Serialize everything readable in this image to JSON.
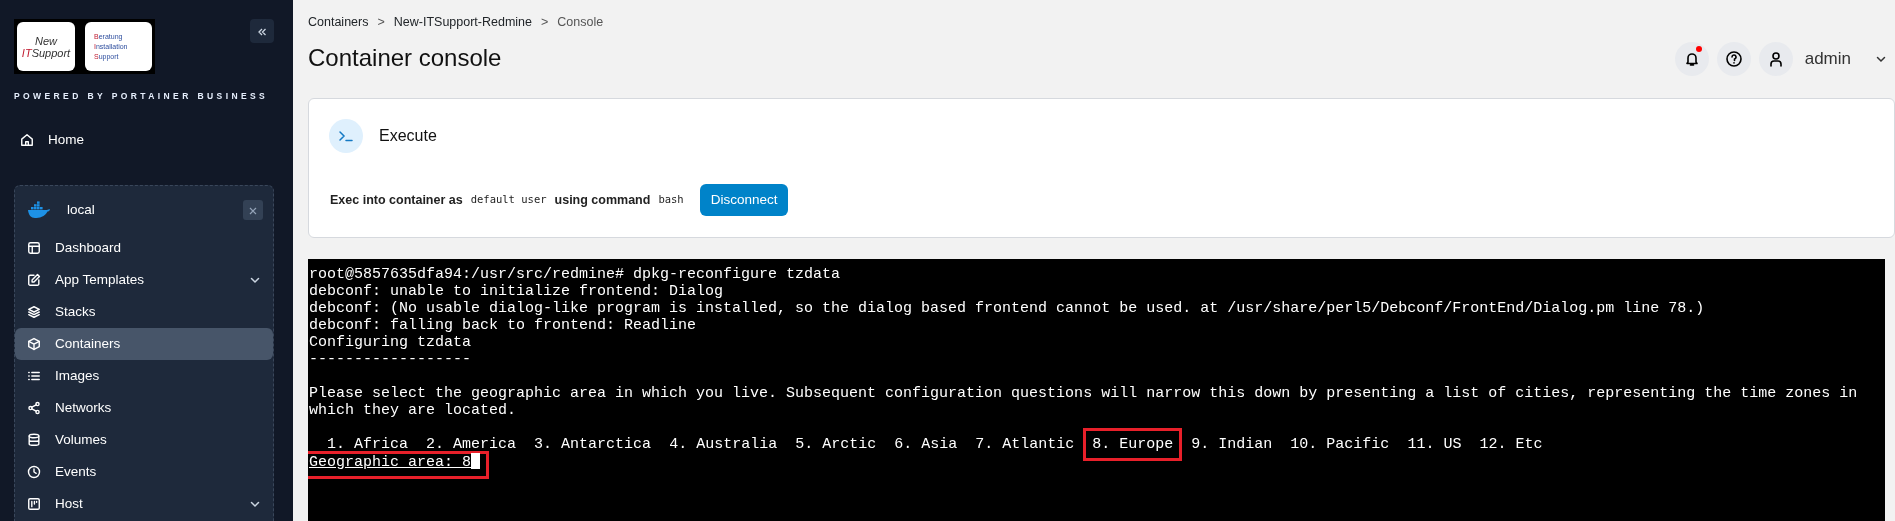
{
  "sidebar": {
    "logo": {
      "left": [
        {
          "text": "New"
        },
        {
          "accent": "IT",
          "text": "Support"
        }
      ],
      "right": [
        {
          "accent": "B",
          "text": "eratung"
        },
        {
          "accent": "I",
          "text": "nstallation"
        },
        {
          "accent": "S",
          "text": "upport"
        }
      ]
    },
    "powered_by": "POWERED BY PORTAINER BUSINESS",
    "home": {
      "label": "Home"
    },
    "environment": {
      "name": "local",
      "items": [
        {
          "label": "Dashboard",
          "expandable": false,
          "selected": false
        },
        {
          "label": "App Templates",
          "expandable": true,
          "selected": false
        },
        {
          "label": "Stacks",
          "expandable": false,
          "selected": false
        },
        {
          "label": "Containers",
          "expandable": false,
          "selected": true
        },
        {
          "label": "Images",
          "expandable": false,
          "selected": false
        },
        {
          "label": "Networks",
          "expandable": false,
          "selected": false
        },
        {
          "label": "Volumes",
          "expandable": false,
          "selected": false
        },
        {
          "label": "Events",
          "expandable": false,
          "selected": false
        },
        {
          "label": "Host",
          "expandable": true,
          "selected": false
        }
      ]
    }
  },
  "breadcrumb": [
    {
      "kind": "link",
      "text": "Containers"
    },
    {
      "kind": "separator",
      "text": ">"
    },
    {
      "kind": "link",
      "text": "New-ITSupport-Redmine"
    },
    {
      "kind": "separator",
      "text": ">"
    },
    {
      "kind": "current",
      "text": "Console"
    }
  ],
  "page_title": "Container console",
  "header": {
    "notification_dot": true,
    "user": "admin"
  },
  "execute_card": {
    "title": "Execute",
    "parts": [
      {
        "kind": "text",
        "text": "Exec into container as"
      },
      {
        "kind": "code",
        "text": "default user"
      },
      {
        "kind": "text",
        "text": "using command"
      },
      {
        "kind": "code",
        "text": "bash"
      }
    ],
    "button": "Disconnect"
  },
  "terminal": {
    "lines": [
      {
        "kind": "text",
        "text": "root@5857635dfa94:/usr/src/redmine# dpkg-reconfigure tzdata"
      },
      {
        "kind": "text",
        "text": "debconf: unable to initialize frontend: Dialog"
      },
      {
        "kind": "text",
        "text": "debconf: (No usable dialog-like program is installed, so the dialog based frontend cannot be used. at /usr/share/perl5/Debconf/FrontEnd/Dialog.pm line 78.)"
      },
      {
        "kind": "text",
        "text": "debconf: falling back to frontend: Readline"
      },
      {
        "kind": "text",
        "text": "Configuring tzdata"
      },
      {
        "kind": "text",
        "text": "------------------"
      },
      {
        "kind": "blank"
      },
      {
        "kind": "text",
        "text": "Please select the geographic area in which you live. Subsequent configuration questions will narrow this down by presenting a list of cities, representing the time zones in"
      },
      {
        "kind": "text",
        "text": "which they are located."
      },
      {
        "kind": "blank"
      },
      {
        "kind": "options",
        "options": [
          {
            "text": "1. Africa",
            "highlighted": false
          },
          {
            "text": "2. America",
            "highlighted": false
          },
          {
            "text": "3. Antarctica",
            "highlighted": false
          },
          {
            "text": "4. Australia",
            "highlighted": false
          },
          {
            "text": "5. Arctic",
            "highlighted": false
          },
          {
            "text": "6. Asia",
            "highlighted": false
          },
          {
            "text": "7. Atlantic",
            "highlighted": false
          },
          {
            "text": "8. Europe",
            "highlighted": true
          },
          {
            "text": "9. Indian",
            "highlighted": false
          },
          {
            "text": "10. Pacific",
            "highlighted": false
          },
          {
            "text": "11. US",
            "highlighted": false
          },
          {
            "text": "12. Etc",
            "highlighted": false
          }
        ]
      },
      {
        "kind": "prompt",
        "text": "Geographic area: 8",
        "highlighted": true,
        "cursor": true
      }
    ]
  }
}
